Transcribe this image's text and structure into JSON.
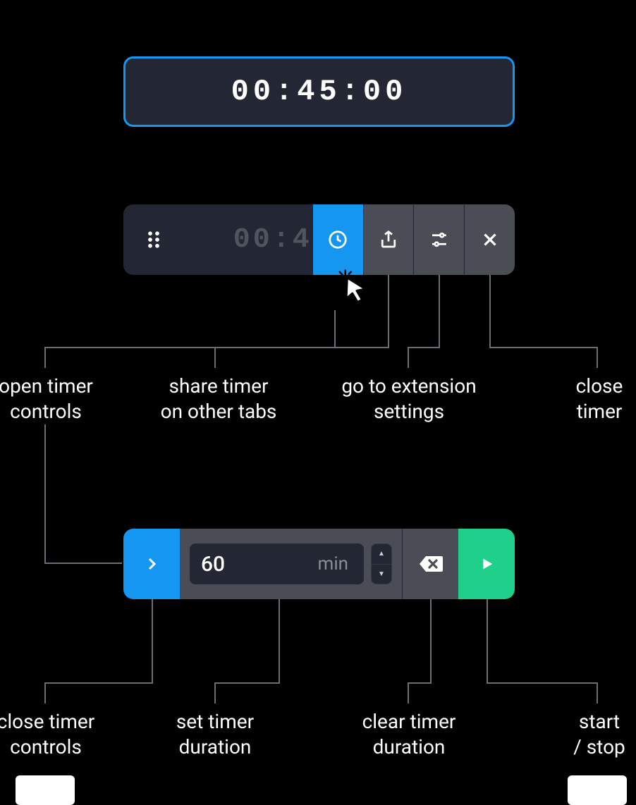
{
  "colors": {
    "panel": "#232734",
    "button": "#4a4d55",
    "accent": "#1596f0",
    "play": "#1fd08a",
    "dim_text": "#50545f"
  },
  "timer_display": {
    "time": "00:45:00"
  },
  "toolbar": {
    "time_preview": "00:4",
    "buttons": {
      "clock": {
        "name": "clock-icon",
        "active": true
      },
      "share": {
        "name": "share-icon",
        "active": false
      },
      "settings": {
        "name": "sliders-icon",
        "active": false
      },
      "close": {
        "name": "close-icon",
        "active": false
      }
    }
  },
  "annotations_row1": {
    "open_controls": "open timer\ncontrols",
    "share": "share timer\non other tabs",
    "settings": "go to extension\nsettings",
    "close": "close\ntimer"
  },
  "controls": {
    "duration_value": "60",
    "duration_unit": "min"
  },
  "annotations_row2": {
    "close_controls": "close timer\ncontrols",
    "set_duration": "set timer\nduration",
    "clear_duration": "clear timer\nduration",
    "start_stop": "start\n/ stop"
  }
}
